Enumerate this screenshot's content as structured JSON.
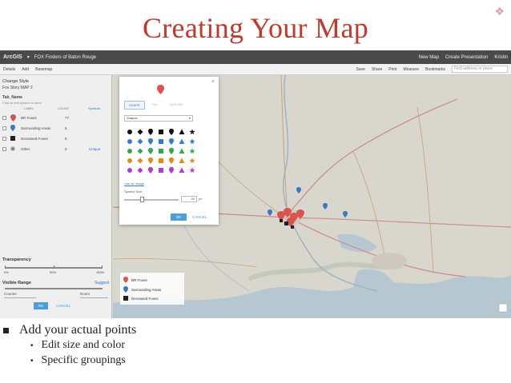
{
  "slide": {
    "title": "Creating Your Map",
    "bullets": [
      {
        "text": "Add your actual points",
        "sub": [
          "Edit size and color",
          "Specific groupings"
        ]
      }
    ]
  },
  "app": {
    "logo": "ArcGIS",
    "map_title": "FOX Finders of Baton Rouge",
    "header_right": [
      "New Map",
      "Create Presentation",
      "Kristin"
    ],
    "toolbar_left": [
      "Details",
      "Add",
      "Basemap"
    ],
    "toolbar_right": [
      "Save",
      "Share",
      "Print",
      "Measure",
      "Bookmarks"
    ],
    "search_placeholder": "Find address or place"
  },
  "left_panel": {
    "heading": "Change Style",
    "layer": "Fox Story MAP 2",
    "field": "Tab_Name",
    "hint": "Click to edit symbol or label",
    "columns": [
      "LABEL",
      "COUNT",
      "Symbols"
    ],
    "rows": [
      {
        "label": "BR Foxes",
        "count": "77",
        "color": "#d9534f"
      },
      {
        "label": "Surrounding Areas",
        "count": "8",
        "color": "#3a78c4"
      },
      {
        "label": "Deceased Foxes",
        "count": "5",
        "color": "#222222"
      },
      {
        "label": "Other",
        "count": "0",
        "action": "Unique"
      }
    ],
    "transparency_label": "Transparency",
    "transparency_ticks": [
      "0%",
      "50%",
      "100%"
    ],
    "visible_range_label": "Visible Range",
    "visible_range_action": "Suggest",
    "range_from": "Counter",
    "range_to": "Room",
    "ok": "OK",
    "cancel": "CANCEL"
  },
  "dialog": {
    "tabs": [
      "SHAPE",
      "FILL",
      "OUTLINE"
    ],
    "select": "Shapes",
    "shape_colors": [
      "#111111",
      "#2f7fd1",
      "#2fa84f",
      "#e08a1e",
      "#b03ccf"
    ],
    "use_image": "Use an Image",
    "symbol_size_label": "Symbol Size",
    "symbol_size": "40",
    "symbol_size_unit": "px",
    "ok": "OK",
    "cancel": "CANCEL"
  },
  "map_legend": [
    {
      "label": "BR Foxes",
      "color": "#d9534f"
    },
    {
      "label": "Surrounding Areas",
      "color": "#3a78c4"
    },
    {
      "label": "Deceased Foxes",
      "color": "#222222"
    }
  ]
}
